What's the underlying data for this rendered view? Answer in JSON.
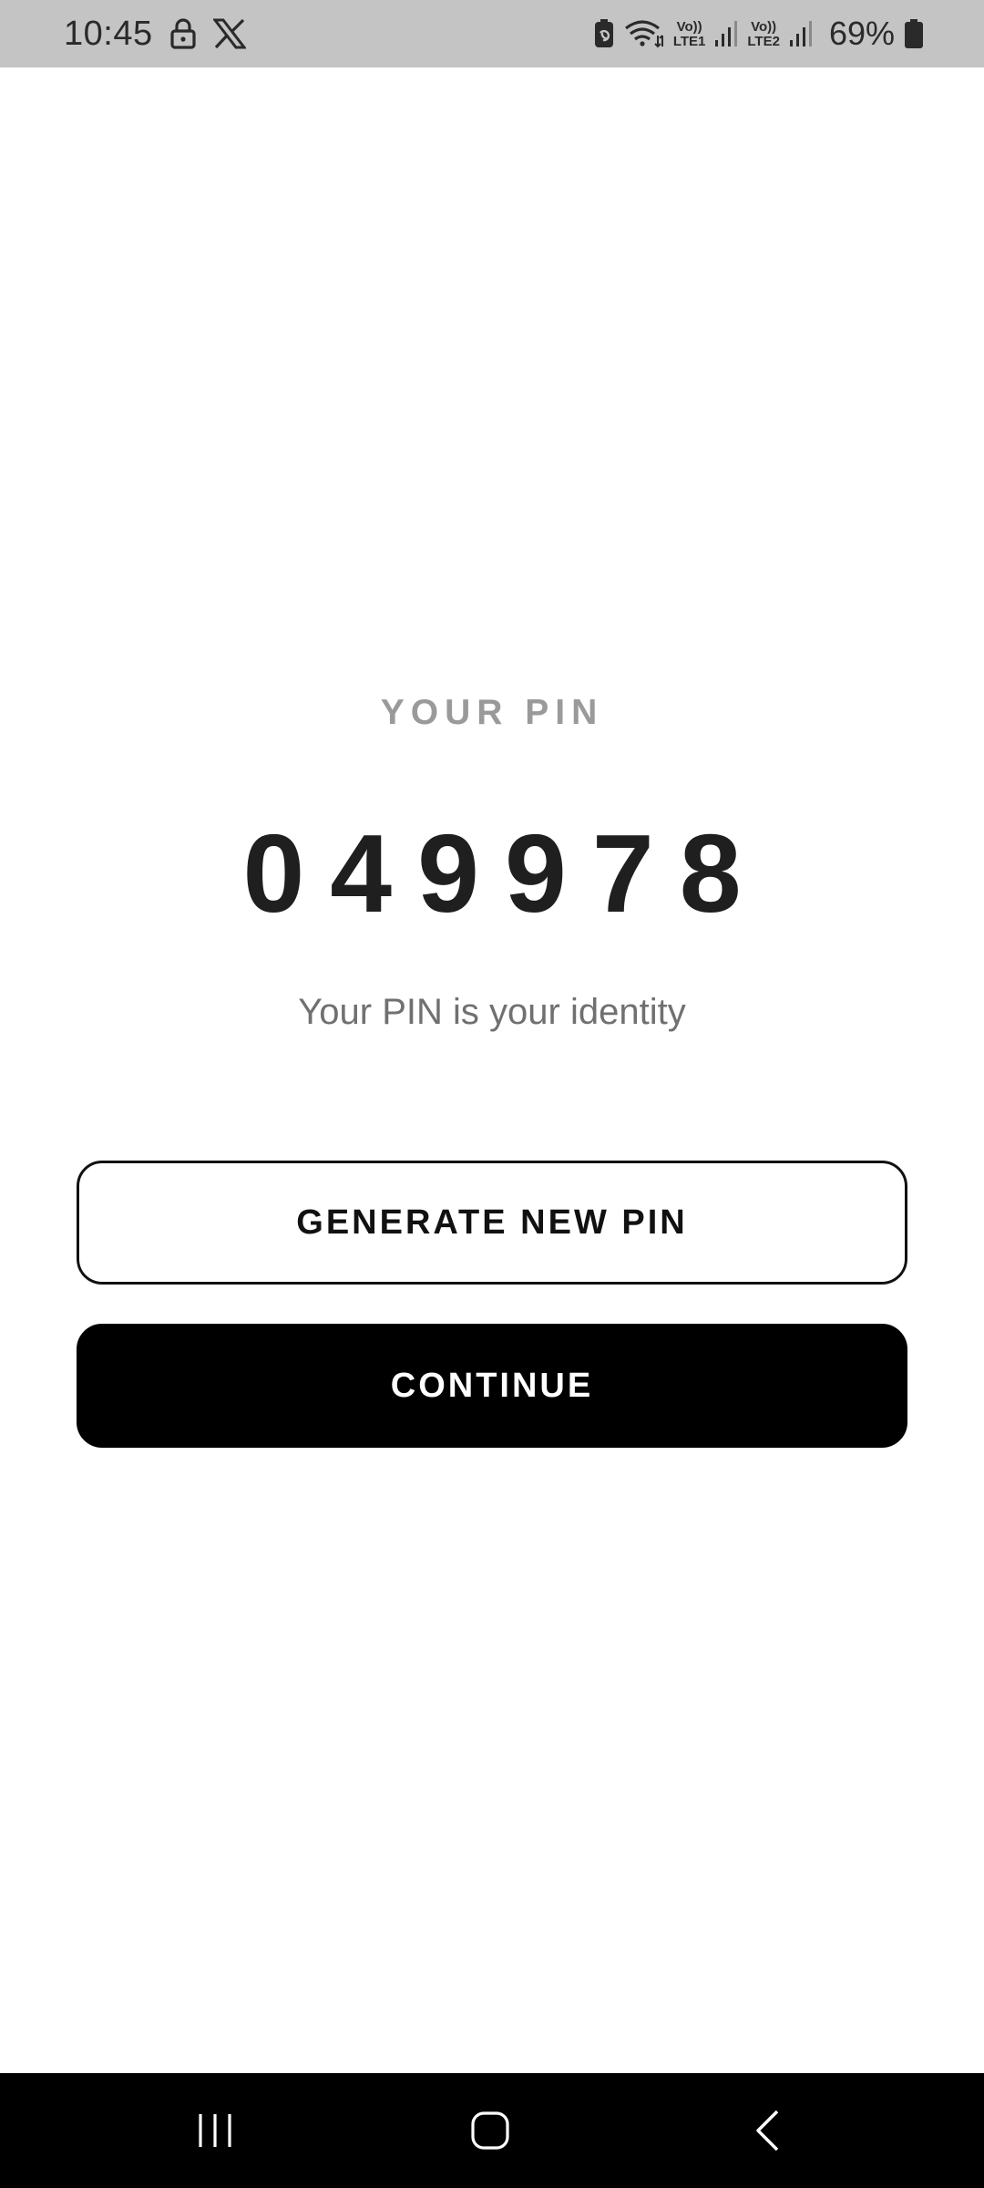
{
  "status_bar": {
    "time": "10:45",
    "battery_percent": "69%",
    "icons": [
      "lock-icon",
      "x-logo-icon",
      "battery-saver-icon",
      "wifi-icon",
      "volte-lte1-icon",
      "signal-icon",
      "volte-lte2-icon",
      "signal-icon",
      "battery-icon"
    ],
    "volte1_top": "Vo))",
    "volte1_bottom": "LTE1",
    "volte2_top": "Vo))",
    "volte2_bottom": "LTE2"
  },
  "main": {
    "pin_label": "YOUR PIN",
    "pin_value": "049978",
    "caption": "Your PIN is your identity",
    "generate_button_label": "GENERATE NEW PIN",
    "continue_button_label": "CONTINUE"
  },
  "nav_bar": {
    "icons": [
      "recents-icon",
      "home-icon",
      "back-icon"
    ]
  },
  "colors": {
    "status_bar_bg": "#c4c4c4",
    "background": "#ffffff",
    "primary_button_bg": "#000000",
    "primary_button_text": "#ffffff",
    "label_gray": "#9a9a9a",
    "caption_gray": "#707070",
    "pin_text": "#1f1f1f"
  }
}
